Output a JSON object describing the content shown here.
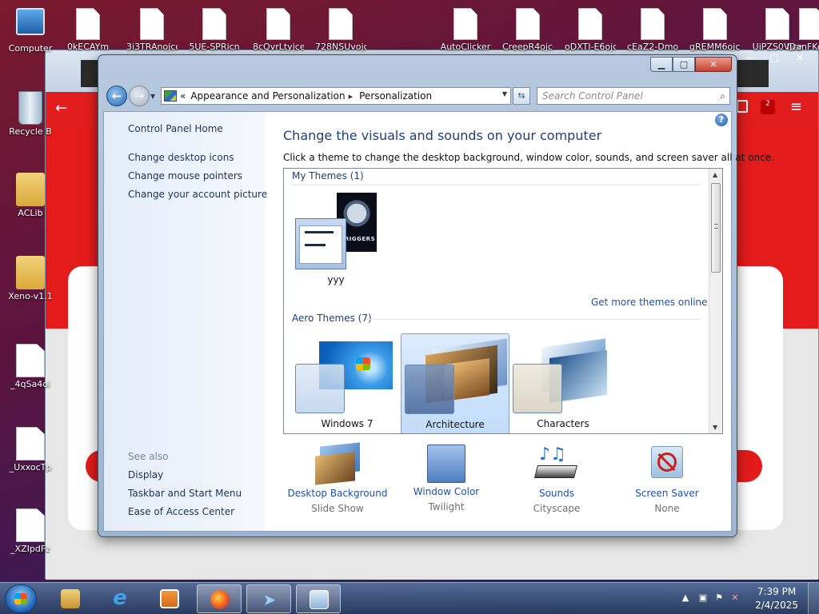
{
  "desktop": {
    "icons": [
      {
        "label": "Computer"
      },
      {
        "label": "Recycle B"
      },
      {
        "label": "ACLib"
      },
      {
        "label": "Xeno-v1.1"
      },
      {
        "label": "_4qSa4oi"
      },
      {
        "label": "_UxxocTp"
      },
      {
        "label": "_XZIpdFz"
      }
    ],
    "top_file_labels": [
      "0kECAYm",
      "3i3TRAnojce",
      "5UE-SPRicn",
      "8cQvrLtyjce",
      "728NSUvojce",
      "AutoClicker",
      "CreepR4ojce",
      "oDXTI-E6ojce",
      "cEaZ2-Dmojce",
      "gREMM6ojce",
      "UiPZS0Vjce",
      "IDanFKojce"
    ]
  },
  "window": {
    "address": {
      "crumb1": "Appearance and Personalization",
      "crumb2": "Personalization",
      "sep_left": "«",
      "sep_mid": "▸"
    },
    "search_placeholder": "Search Control Panel",
    "left_pane": {
      "home": "Control Panel Home",
      "links": [
        "Change desktop icons",
        "Change mouse pointers",
        "Change your account picture"
      ],
      "see_also": "See also",
      "see_also_links": [
        "Display",
        "Taskbar and Start Menu",
        "Ease of Access Center"
      ]
    },
    "main": {
      "title": "Change the visuals and sounds on your computer",
      "description": "Click a theme to change the desktop background, window color, sounds, and screen saver all at once.",
      "my_themes_header": "My Themes (1)",
      "my_theme_name": "yyy",
      "my_theme_wallpaper_text": "VRIGGERS",
      "get_more": "Get more themes online",
      "aero_header": "Aero Themes (7)",
      "aero_themes": [
        {
          "name": "Windows 7"
        },
        {
          "name": "Architecture",
          "selected": true
        },
        {
          "name": "Characters"
        }
      ]
    },
    "bottom": [
      {
        "title": "Desktop Background",
        "sub": "Slide Show"
      },
      {
        "title": "Window Color",
        "sub": "Twilight"
      },
      {
        "title": "Sounds",
        "sub": "Cityscape"
      },
      {
        "title": "Screen Saver",
        "sub": "None"
      }
    ]
  },
  "browser": {
    "ext_badge": "2"
  },
  "taskbar": {
    "time": "7:39 PM",
    "date": "2/4/2025"
  },
  "colors": {
    "link": "#1f4fa6",
    "title": "#1e3d7a",
    "selection": "#c1dcfa"
  }
}
